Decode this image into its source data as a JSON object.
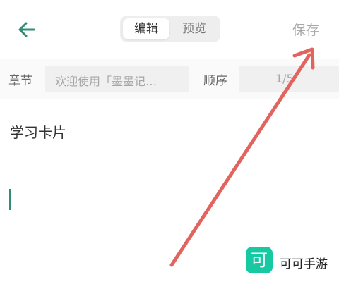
{
  "header": {
    "back_icon": "arrow-left-icon",
    "tabs": [
      {
        "label": "编辑",
        "active": true
      },
      {
        "label": "预览",
        "active": false
      }
    ],
    "save_label": "保存"
  },
  "meta": {
    "chapter_label": "章节",
    "chapter_value": "欢迎使用「墨墨记…",
    "order_label": "顺序",
    "order_value": "1/5"
  },
  "card": {
    "title": "学习卡片"
  },
  "watermark": {
    "icon_char": "可",
    "text": "可可手游"
  },
  "colors": {
    "accent": "#2f8f74",
    "arrow": "#e2645e",
    "watermark": "#16c9a2"
  }
}
